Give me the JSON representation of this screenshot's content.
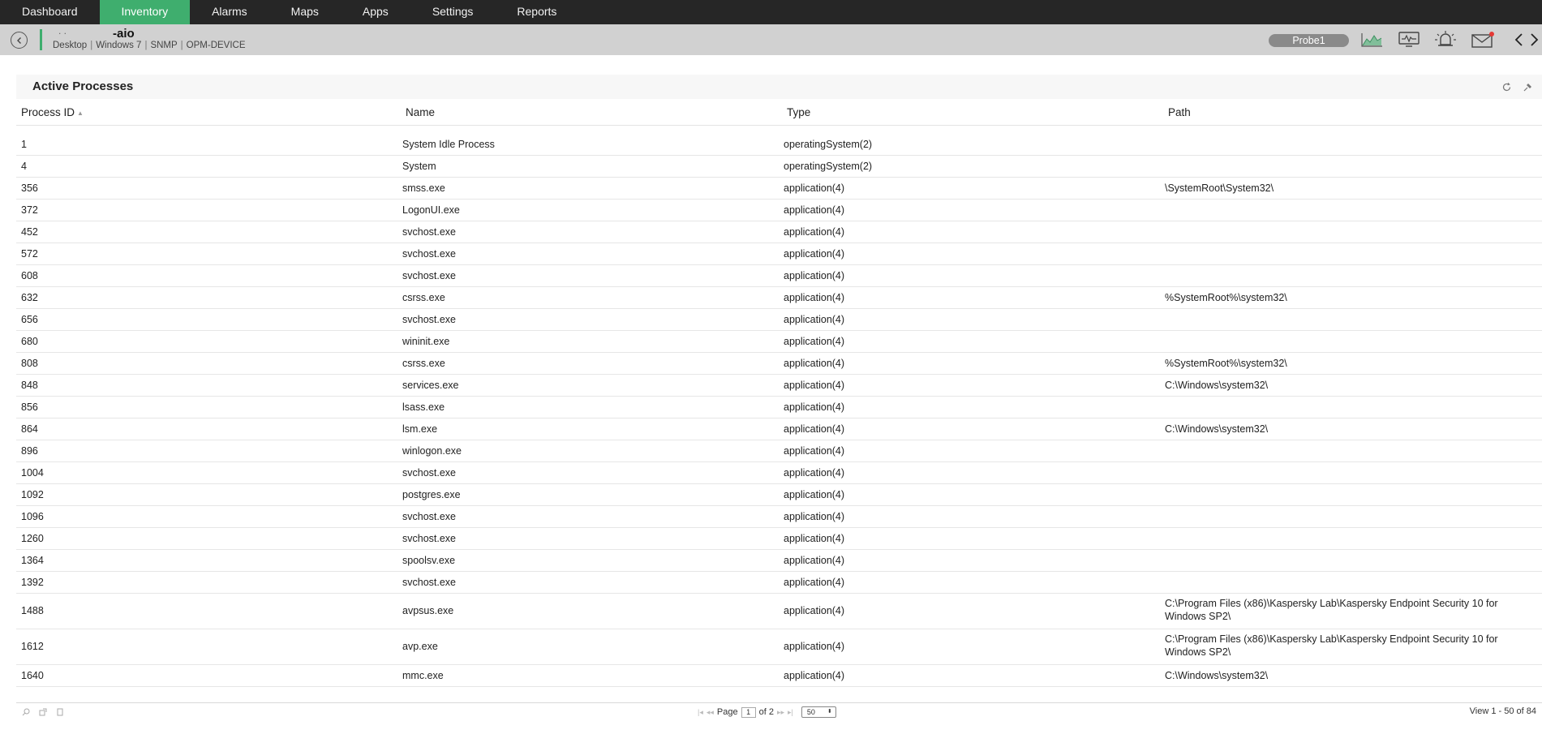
{
  "nav": {
    "items": [
      {
        "label": "Dashboard",
        "active": false
      },
      {
        "label": "Inventory",
        "active": true
      },
      {
        "label": "Alarms",
        "active": false
      },
      {
        "label": "Maps",
        "active": false
      },
      {
        "label": "Apps",
        "active": false
      },
      {
        "label": "Settings",
        "active": false
      },
      {
        "label": "Reports",
        "active": false
      }
    ]
  },
  "device": {
    "name_prefix": ". .",
    "name": "-aio",
    "meta": [
      "Desktop",
      "Windows 7",
      "SNMP",
      "OPM-DEVICE"
    ],
    "probe": "Probe1",
    "icons": [
      "area-chart-icon",
      "monitor-icon",
      "alarm-bell-icon",
      "mail-icon",
      "chevron-left-icon",
      "chevron-right-icon"
    ]
  },
  "panel": {
    "title": "Active Processes",
    "columns": [
      "Process ID",
      "Name",
      "Type",
      "Path"
    ],
    "rows": [
      {
        "pid": "1",
        "name": "System Idle Process",
        "type": "operatingSystem(2)",
        "path": ""
      },
      {
        "pid": "4",
        "name": "System",
        "type": "operatingSystem(2)",
        "path": ""
      },
      {
        "pid": "356",
        "name": "smss.exe",
        "type": "application(4)",
        "path": "\\SystemRoot\\System32\\"
      },
      {
        "pid": "372",
        "name": "LogonUI.exe",
        "type": "application(4)",
        "path": ""
      },
      {
        "pid": "452",
        "name": "svchost.exe",
        "type": "application(4)",
        "path": ""
      },
      {
        "pid": "572",
        "name": "svchost.exe",
        "type": "application(4)",
        "path": ""
      },
      {
        "pid": "608",
        "name": "svchost.exe",
        "type": "application(4)",
        "path": ""
      },
      {
        "pid": "632",
        "name": "csrss.exe",
        "type": "application(4)",
        "path": "%SystemRoot%\\system32\\"
      },
      {
        "pid": "656",
        "name": "svchost.exe",
        "type": "application(4)",
        "path": ""
      },
      {
        "pid": "680",
        "name": "wininit.exe",
        "type": "application(4)",
        "path": ""
      },
      {
        "pid": "808",
        "name": "csrss.exe",
        "type": "application(4)",
        "path": "%SystemRoot%\\system32\\"
      },
      {
        "pid": "848",
        "name": "services.exe",
        "type": "application(4)",
        "path": "C:\\Windows\\system32\\"
      },
      {
        "pid": "856",
        "name": "lsass.exe",
        "type": "application(4)",
        "path": ""
      },
      {
        "pid": "864",
        "name": "lsm.exe",
        "type": "application(4)",
        "path": "C:\\Windows\\system32\\"
      },
      {
        "pid": "896",
        "name": "winlogon.exe",
        "type": "application(4)",
        "path": ""
      },
      {
        "pid": "1004",
        "name": "svchost.exe",
        "type": "application(4)",
        "path": ""
      },
      {
        "pid": "1092",
        "name": "postgres.exe",
        "type": "application(4)",
        "path": ""
      },
      {
        "pid": "1096",
        "name": "svchost.exe",
        "type": "application(4)",
        "path": ""
      },
      {
        "pid": "1260",
        "name": "svchost.exe",
        "type": "application(4)",
        "path": ""
      },
      {
        "pid": "1364",
        "name": "spoolsv.exe",
        "type": "application(4)",
        "path": ""
      },
      {
        "pid": "1392",
        "name": "svchost.exe",
        "type": "application(4)",
        "path": ""
      },
      {
        "pid": "1488",
        "name": "avpsus.exe",
        "type": "application(4)",
        "path": "C:\\Program Files (x86)\\Kaspersky Lab\\Kaspersky Endpoint Security 10 for Windows SP2\\"
      },
      {
        "pid": "1612",
        "name": "avp.exe",
        "type": "application(4)",
        "path": "C:\\Program Files (x86)\\Kaspersky Lab\\Kaspersky Endpoint Security 10 for Windows SP2\\"
      },
      {
        "pid": "1640",
        "name": "mmc.exe",
        "type": "application(4)",
        "path": "C:\\Windows\\system32\\"
      }
    ]
  },
  "pager": {
    "page_label": "Page",
    "page_value": "1",
    "of_label": "of 2",
    "page_size": "50",
    "view_text": "View 1 - 50 of 84"
  },
  "colors": {
    "nav_bg": "#262626",
    "active": "#3fae6e",
    "devbar_bg": "#d1d1d1"
  }
}
